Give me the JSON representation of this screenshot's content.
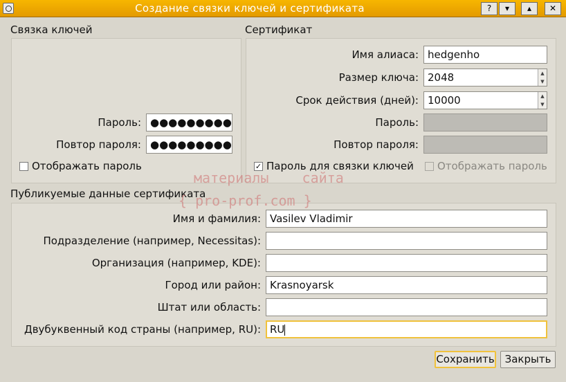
{
  "window": {
    "title": "Создание связки ключей и сертификата",
    "help_button": "?",
    "shade_button": "▾",
    "max_button": "▴",
    "close_button": "✕"
  },
  "keystore": {
    "title": "Связка ключей",
    "password_label": "Пароль:",
    "password_value": "●●●●●●●●●",
    "repeat_label": "Повтор пароля:",
    "repeat_value": "●●●●●●●●●",
    "show_label": "Отображать пароль",
    "show_checked": false
  },
  "certificate": {
    "title": "Сертификат",
    "alias_label": "Имя алиаса:",
    "alias_value": "hedgenho",
    "keysize_label": "Размер ключа:",
    "keysize_value": "2048",
    "validity_label": "Срок действия (дней):",
    "validity_value": "10000",
    "password_label": "Пароль:",
    "repeat_label": "Повтор пароля:",
    "use_keystore_label": "Пароль для связки ключей",
    "use_keystore_checked": "✓",
    "show_label": "Отображать пароль"
  },
  "public": {
    "title": "Публикуемые данные сертификата",
    "name_label": "Имя и фамилия:",
    "name_value": "Vasilev Vladimir",
    "unit_label": "Подразделение (например, Necessitas):",
    "unit_value": "",
    "org_label": "Организация (например, KDE):",
    "org_value": "",
    "city_label": "Город или район:",
    "city_value": "Krasnoyarsk",
    "state_label": "Штат или область:",
    "state_value": "",
    "country_label": "Двубуквенный код страны (например, RU):",
    "country_value": "RU"
  },
  "buttons": {
    "save": "Сохранить",
    "close": "Закрыть"
  },
  "watermark": {
    "line1": "материалы    сайта",
    "line2": "{ pro-prof.com }"
  }
}
